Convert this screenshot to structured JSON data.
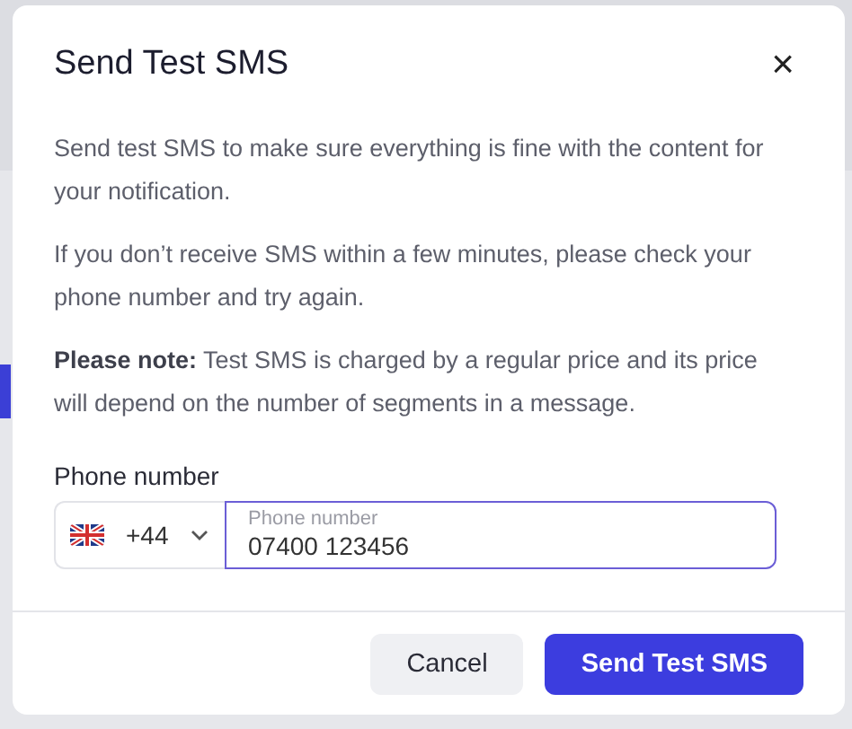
{
  "dialog": {
    "title": "Send Test SMS",
    "close": "×",
    "paragraphs": [
      "Send test SMS to make sure everything is fine with the content for your notification.",
      "If you don’t receive SMS within a few minutes, please check your phone number and try again.",
      "**Please note:** Test SMS is charged by a regular price and its price will depend on the number of segments in a message."
    ],
    "phone": {
      "label": "Phone number",
      "country_code": "+44",
      "placeholder": "Phone number",
      "value": "07400 123456",
      "focused": true
    },
    "buttons": [
      {
        "label": "Cancel",
        "kind": "secondary"
      },
      {
        "label": "Send Test SMS",
        "kind": "primary"
      }
    ]
  }
}
